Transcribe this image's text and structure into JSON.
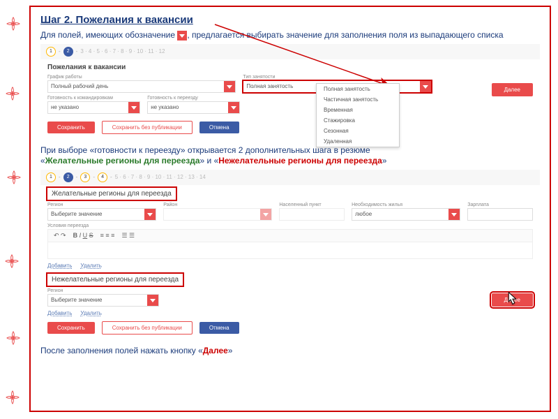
{
  "title": "Шаг 2. Пожелания к вакансии",
  "intro_a": "Для полей, имеющих обозначение ",
  "intro_b": ", предлагается выбирать значение для заполнения поля из выпадающего списка",
  "shot1": {
    "section": "Пожелания к вакансии",
    "schedule_lbl": "График работы",
    "schedule_val": "Полный рабочий день",
    "ready_biz_lbl": "Готовность к командировкам",
    "ready_biz_val": "не указано",
    "ready_move_lbl": "Готовность к переезду",
    "ready_move_val": "не указано",
    "emp_type_lbl": "Тип занятости",
    "emp_type_val": "Полная занятость",
    "menu": [
      "Полная занятость",
      "Частичная занятость",
      "Временная",
      "Стажировка",
      "Сезонная",
      "Удаленная"
    ],
    "save": "Сохранить",
    "save_np": "Сохранить без публикации",
    "cancel": "Отмена",
    "next": "Далее"
  },
  "note2_a": "При выборе «готовности к переезду» открывается 2 дополнительных шага в резюме",
  "note2_b": "«",
  "note2_green": "Желательные регионы для переезда",
  "note2_c": "» и «",
  "note2_red": "Нежелательные регионы для переезда",
  "note2_d": "»",
  "shot2": {
    "title1": "Желательные регионы для переезда",
    "region_lbl": "Регион",
    "region_val": "Выберите значение",
    "district_lbl": "Район",
    "district_val": "",
    "city_lbl": "Населенный пункт",
    "city_val": "",
    "housing_lbl": "Необходимость жилья",
    "housing_val": "любое",
    "salary_lbl": "Зарплата",
    "cond_lbl": "Условия переезда",
    "add": "Добавить",
    "del": "Удалить",
    "title2": "Нежелательные регионы для переезда",
    "save": "Сохранить",
    "save_np": "Сохранить без публикации",
    "cancel": "Отмена",
    "next": "Далее"
  },
  "final_a": "После заполнения полей нажать кнопку «",
  "final_b": "Далее",
  "final_c": "»"
}
